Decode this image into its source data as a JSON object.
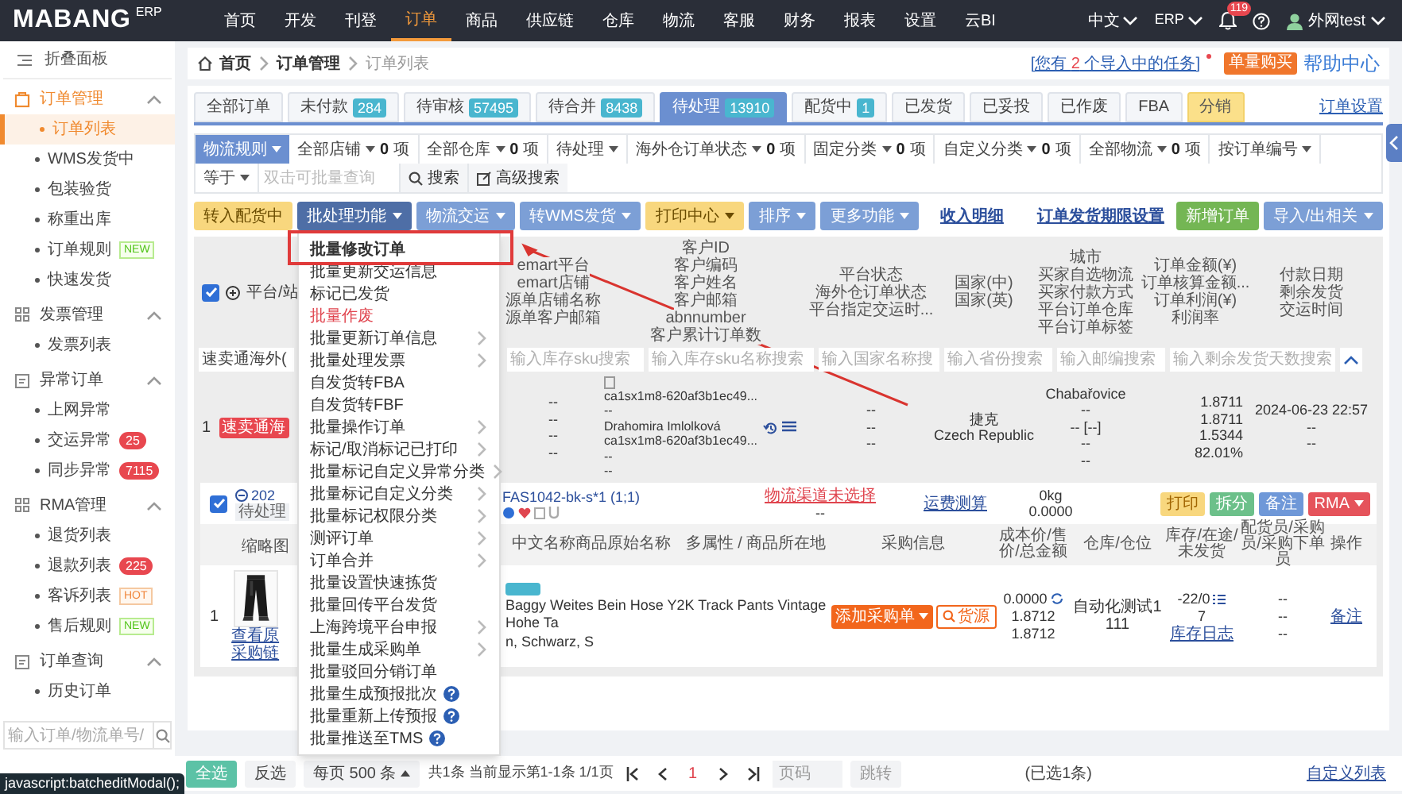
{
  "nav": {
    "logo": "MABANG",
    "logo_suffix": "ERP",
    "items": [
      {
        "label": "首页",
        "selected": false
      },
      {
        "label": "开发",
        "selected": false
      },
      {
        "label": "刊登",
        "selected": false
      },
      {
        "label": "订单",
        "selected": true
      },
      {
        "label": "商品",
        "selected": false
      },
      {
        "label": "供应链",
        "selected": false
      },
      {
        "label": "仓库",
        "selected": false
      },
      {
        "label": "物流",
        "selected": false
      },
      {
        "label": "客服",
        "selected": false
      },
      {
        "label": "财务",
        "selected": false
      },
      {
        "label": "报表",
        "selected": false
      },
      {
        "label": "设置",
        "selected": false
      },
      {
        "label": "云BI",
        "selected": false
      }
    ],
    "language": "中文",
    "system": "ERP",
    "notifications": "119",
    "user": "外网test"
  },
  "sidebar": {
    "collapse": "折叠面板",
    "groups": [
      {
        "label": "订单管理",
        "expanded": true,
        "items": [
          {
            "label": "订单列表",
            "selected": true
          },
          {
            "label": "WMS发货中",
            "selected": false
          },
          {
            "label": "包装验货",
            "selected": false
          },
          {
            "label": "称重出库",
            "selected": false
          },
          {
            "label": "订单规则",
            "selected": false,
            "badge": "NEW",
            "kind": "new"
          },
          {
            "label": "快速发货",
            "selected": false
          }
        ]
      },
      {
        "label": "发票管理",
        "expanded": true,
        "items": [
          {
            "label": "发票列表",
            "selected": false
          }
        ]
      },
      {
        "label": "异常订单",
        "expanded": true,
        "items": [
          {
            "label": "上网异常",
            "selected": false
          },
          {
            "label": "交运异常",
            "selected": false,
            "badge": "25",
            "kind": "count"
          },
          {
            "label": "同步异常",
            "selected": false,
            "badge": "7115",
            "kind": "count"
          }
        ]
      },
      {
        "label": "RMA管理",
        "expanded": true,
        "items": [
          {
            "label": "退货列表",
            "selected": false
          },
          {
            "label": "退款列表",
            "selected": false,
            "badge": "225",
            "kind": "count"
          },
          {
            "label": "客诉列表",
            "selected": false,
            "badge": "HOT",
            "kind": "hot"
          },
          {
            "label": "售后规则",
            "selected": false,
            "badge": "NEW",
            "kind": "new"
          }
        ]
      },
      {
        "label": "订单查询",
        "expanded": true,
        "items": [
          {
            "label": "历史订单",
            "selected": false
          }
        ]
      }
    ],
    "search_placeholder": "输入订单/物流单号/"
  },
  "status_link": "javascript:batcheditModal();",
  "breadcrumb": [
    "首页",
    "订单管理",
    "订单列表"
  ],
  "tasks": {
    "prefix": "[您有",
    "count": "2",
    "suffix": "个导入中的任务]"
  },
  "buy_button": "单量购买",
  "help": "帮助中心",
  "tabs": [
    {
      "label": "全部订单",
      "selected": false
    },
    {
      "label": "未付款",
      "count": "284",
      "selected": false
    },
    {
      "label": "待审核",
      "count": "57495",
      "selected": false
    },
    {
      "label": "待合并",
      "count": "8438",
      "selected": false
    },
    {
      "label": "待处理",
      "count": "13910",
      "selected": true
    },
    {
      "label": "配货中",
      "count": "1",
      "selected": false
    },
    {
      "label": "已发货",
      "selected": false
    },
    {
      "label": "已妥投",
      "selected": false
    },
    {
      "label": "已作废",
      "selected": false
    },
    {
      "label": "FBA",
      "selected": false
    },
    {
      "label": "分销",
      "selected": false,
      "kind": "highlight"
    }
  ],
  "order_settings": "订单设置",
  "filters": [
    {
      "label": "物流规则",
      "kind": "button"
    },
    {
      "label": "全部店铺",
      "count": "0",
      "unit": "项",
      "kind": "select"
    },
    {
      "label": "全部仓库",
      "count": "0",
      "unit": "项",
      "kind": "select"
    },
    {
      "label": "待处理",
      "kind": "select"
    },
    {
      "label": "海外仓订单状态",
      "count": "0",
      "unit": "项",
      "kind": "select"
    },
    {
      "label": "固定分类",
      "count": "0",
      "unit": "项",
      "kind": "select"
    },
    {
      "label": "自定义分类",
      "count": "0",
      "unit": "项",
      "kind": "select"
    },
    {
      "label": "全部物流",
      "count": "0",
      "unit": "项",
      "kind": "select"
    },
    {
      "label": "按订单编号",
      "kind": "select"
    },
    {
      "label": "等于",
      "kind": "select"
    }
  ],
  "search": {
    "placeholder": "双击可批量查询",
    "button": "搜索",
    "advanced": "高级搜索"
  },
  "actions": [
    {
      "label": "转入配货中",
      "color": "#f8d77e",
      "dropdown": false
    },
    {
      "label": "批处理功能",
      "color": "#4e6ea6",
      "dropdown": true
    },
    {
      "label": "物流交运",
      "color": "#7c9fd6",
      "dropdown": true
    },
    {
      "label": "转WMS发货",
      "color": "#7c9fd6",
      "dropdown": true
    },
    {
      "label": "打印中心",
      "color": "#f8d77e",
      "dropdown": true
    },
    {
      "label": "排序",
      "color": "#7c9fd6",
      "dropdown": true
    },
    {
      "label": "更多功能",
      "color": "#7c9fd6",
      "dropdown": true
    }
  ],
  "links": [
    "收入明细",
    "订单发货期限设置"
  ],
  "right_actions": [
    {
      "label": "新增订单",
      "color": "#74b654",
      "dropdown": false
    },
    {
      "label": "导入/出相关",
      "color": "#7c9fd6",
      "dropdown": true
    }
  ],
  "menu": {
    "items": [
      {
        "label": "批量修改订单",
        "highlighted": true
      },
      {
        "label": "批量更新交运信息",
        "highlighted": false
      },
      {
        "label": "标记已发货",
        "highlighted": false
      },
      {
        "label": "批量作废",
        "highlighted": false,
        "danger": true
      },
      {
        "label": "批量更新订单信息",
        "highlighted": false,
        "submenu": true
      },
      {
        "label": "批量处理发票",
        "highlighted": false,
        "submenu": true
      },
      {
        "label": "自发货转FBA",
        "highlighted": false
      },
      {
        "label": "自发货转FBF",
        "highlighted": false
      },
      {
        "label": "批量操作订单",
        "highlighted": false,
        "submenu": true
      },
      {
        "label": "标记/取消标记已打印",
        "highlighted": false,
        "submenu": true
      },
      {
        "label": "批量标记自定义异常分类",
        "highlighted": false,
        "submenu": true
      },
      {
        "label": "批量标记自定义分类",
        "highlighted": false,
        "submenu": true
      },
      {
        "label": "批量标记权限分类",
        "highlighted": false,
        "submenu": true
      },
      {
        "label": "测评订单",
        "highlighted": false,
        "submenu": true
      },
      {
        "label": "订单合并",
        "highlighted": false,
        "submenu": true
      },
      {
        "label": "批量设置快速拣货",
        "highlighted": false
      },
      {
        "label": "批量回传平台发货",
        "highlighted": false
      },
      {
        "label": "上海跨境平台申报",
        "highlighted": false,
        "submenu": true
      },
      {
        "label": "批量生成采购单",
        "highlighted": false,
        "submenu": true
      },
      {
        "label": "批量驳回分销订单",
        "highlighted": false
      },
      {
        "label": "批量生成预报批次",
        "highlighted": false,
        "help": true
      },
      {
        "label": "批量重新上传预报",
        "highlighted": false,
        "help": true
      },
      {
        "label": "批量推送至TMS",
        "highlighted": false,
        "help": true
      }
    ]
  },
  "table": {
    "select_all": true,
    "first_column": "平台/站",
    "columns": [
      [
        "emart平台",
        "emart店铺",
        "源单店铺名称",
        "源单客户邮箱"
      ],
      [
        "客户ID",
        "客户编码",
        "客户姓名",
        "客户邮箱",
        "abnnumber",
        "客户累计订单数"
      ],
      [
        "平台状态",
        "海外仓订单状态",
        "平台指定交运时..."
      ],
      [
        "国家(中)",
        "国家(英)"
      ],
      [
        "城市",
        "买家自选物流",
        "买家付款方式",
        "平台订单仓库",
        "平台订单标签"
      ],
      [
        "订单金额(¥)",
        "订单核算金额...",
        "订单利润(¥)",
        "利润率"
      ],
      [
        "付款日期",
        "剩余发货",
        "交运时间"
      ]
    ],
    "platform_filter": "速卖通海外(",
    "filter_placeholders": [
      "输入库存sku搜索",
      "输入库存sku名称搜索",
      "输入国家名称搜",
      "输入省份搜索",
      "输入邮编搜索",
      "输入剩余发货天数搜索"
    ]
  },
  "order": {
    "index": "1",
    "tag": "速卖通海",
    "cells": [
      {
        "kind": "text",
        "lines": [
          "--",
          "--",
          "--",
          "--"
        ]
      },
      {
        "kind": "customer",
        "lines": [
          "ca1sx1m8-620af3b1ec49...",
          "--",
          "Drahomira Imlolková",
          "ca1sx1m8-620af3b1ec49...",
          "--",
          "--"
        ]
      },
      {
        "kind": "text",
        "lines": [
          "--",
          "--",
          "--"
        ]
      },
      {
        "kind": "text",
        "lines": [
          "捷克",
          "Czech Republic"
        ]
      },
      {
        "kind": "text",
        "lines": [
          "Chabařovice",
          "--",
          "-- [--]",
          "--",
          "--"
        ]
      },
      {
        "kind": "amount",
        "lines": [
          "1.8711",
          "1.8711",
          "1.5344",
          "82.01%"
        ]
      },
      {
        "kind": "text",
        "lines": [
          "2024-06-23 22:57",
          "--",
          "--"
        ]
      }
    ]
  },
  "package": {
    "checked": true,
    "date": "202",
    "status": "待处理",
    "sku": "FAS1042-bk-s*1 (1;1)",
    "logistics": "物流渠道未选择",
    "logistics_note": "--",
    "freight": "运费测算",
    "weight": "0kg",
    "cost": "0.0000",
    "buttons": [
      {
        "label": "打印",
        "color": "#f8d77e",
        "dropdown": false
      },
      {
        "label": "拆分",
        "color": "#6cc08a",
        "dropdown": false
      },
      {
        "label": "备注",
        "color": "#6f98d8",
        "dropdown": false
      },
      {
        "label": "RMA",
        "color": "#e5535b",
        "dropdown": true
      }
    ]
  },
  "products": {
    "columns": [
      "缩略图",
      "中文名称商品原始名称",
      "多属性 / 商品所在地",
      "采购信息",
      "成本价/售价/总金额",
      "仓库/仓位",
      "库存/在途/未发货",
      "配货员/采购员/采购下单员",
      "操作"
    ],
    "rows": [
      {
        "index": "1",
        "links": [
          "查看原",
          "采购链"
        ],
        "name": "Baggy Weites Bein Hose Y2K Track Pants Vintage Hohe Ta",
        "name_rest": "n, Schwarz, S",
        "purchase": "添加采购单",
        "source": "货源",
        "prices": [
          "0.0000",
          "1.8712",
          "1.8712"
        ],
        "warehouse": [
          "自动化测试1",
          "111"
        ],
        "stock": [
          "-22/0",
          "7"
        ],
        "stock_log": "库存日志",
        "staff": [
          "--",
          "--",
          "--"
        ],
        "action": "备注"
      }
    ]
  },
  "pager": {
    "select_all": "全选",
    "invert": "反选",
    "page_size": "每页 500 条",
    "summary": "共1条 当前显示第1-1条 1/1页",
    "pages": [
      {
        "label": "1",
        "selected": true
      }
    ],
    "page_placeholder": "页码",
    "go": "跳转",
    "selected_count": "(已选1条)",
    "columns_link": "自定义列表"
  }
}
